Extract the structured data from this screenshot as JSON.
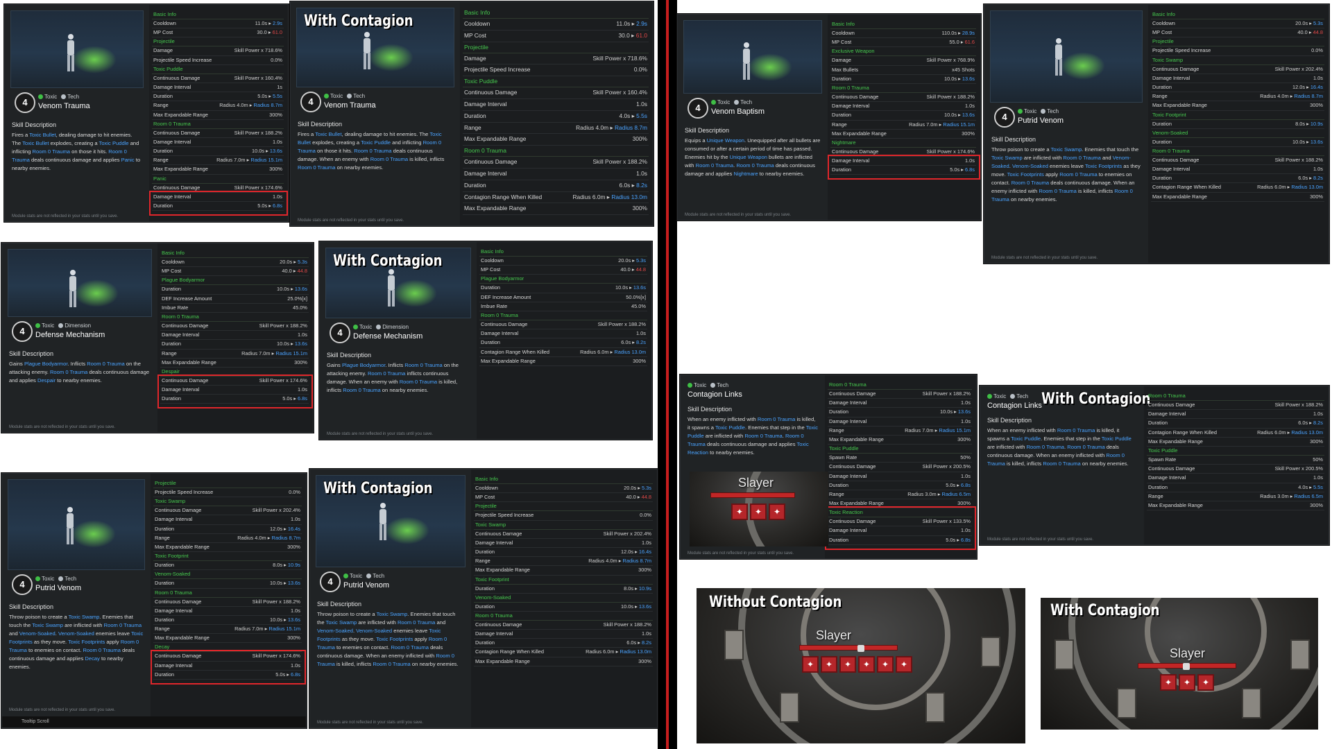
{
  "labels": {
    "skill_description": "Skill Description",
    "with_contagion": "With Contagion",
    "without_contagion": "Without Contagion",
    "module_note": "Module stats are not reflected in your stats until you save.",
    "tooltip_scroll": "Tooltip Scroll",
    "slayer": "Slayer"
  },
  "cards": {
    "venom_base": {
      "level": "4",
      "tag1": "Toxic",
      "tag2": "Tech",
      "name": "Venom Trauma",
      "desc": "Fires a Toxic Bullet, dealing damage to hit enemies. The Toxic Bullet explodes, creating a Toxic Puddle and inflicting Room 0 Trauma on those it hits. Room 0 Trauma deals continuous damage and applies Panic to nearby enemies.",
      "rows": [
        [
          "sec",
          "Basic Info"
        ],
        [
          "Cooldown",
          "11.0s ▸ 2.9s"
        ],
        [
          "MP Cost",
          "30.0 ▸ 61.0"
        ],
        [
          "sec",
          "Projectile"
        ],
        [
          "Damage",
          "Skill Power x 718.6%"
        ],
        [
          "Projectile Speed Increase",
          "0.0%"
        ],
        [
          "sec",
          "Toxic Puddle"
        ],
        [
          "Continuous Damage",
          "Skill Power x 160.4%"
        ],
        [
          "Damage Interval",
          "1s"
        ],
        [
          "Duration",
          "5.0s ▸ 5.5s"
        ],
        [
          "Range",
          "Radius 4.0m ▸ Radius 8.7m"
        ],
        [
          "Max Expandable Range",
          "300%"
        ],
        [
          "sec",
          "Room 0 Trauma"
        ],
        [
          "Continuous Damage",
          "Skill Power x 188.2%"
        ],
        [
          "Damage Interval",
          "1.0s"
        ],
        [
          "Duration",
          "10.0s ▸ 13.6s"
        ],
        [
          "Range",
          "Radius 7.0m ▸ Radius 15.1m"
        ],
        [
          "Max Expandable Range",
          "300%"
        ],
        [
          "sec",
          "Panic"
        ],
        [
          "Continuous Damage",
          "Skill Power x 174.6%"
        ],
        [
          "Damage Interval",
          "1.0s"
        ],
        [
          "Duration",
          "5.0s ▸ 6.8s"
        ]
      ]
    },
    "venom_cont": {
      "level": "4",
      "tag1": "Toxic",
      "tag2": "Tech",
      "name": "Venom Trauma",
      "desc": "Fires a Toxic Bullet, dealing damage to hit enemies. The Toxic Bullet explodes, creating a Toxic Puddle and inflicting Room 0 Trauma on those it hits. Room 0 Trauma deals continuous damage. When an enemy with Room 0 Trauma is killed, inflicts Room 0 Trauma on nearby enemies.",
      "rows": [
        [
          "sec",
          "Basic Info"
        ],
        [
          "Cooldown",
          "11.0s ▸ 2.9s"
        ],
        [
          "MP Cost",
          "30.0 ▸ 61.0"
        ],
        [
          "sec",
          "Projectile"
        ],
        [
          "Damage",
          "Skill Power x 718.6%"
        ],
        [
          "Projectile Speed Increase",
          "0.0%"
        ],
        [
          "sec",
          "Toxic Puddle"
        ],
        [
          "Continuous Damage",
          "Skill Power x 160.4%"
        ],
        [
          "Damage Interval",
          "1.0s"
        ],
        [
          "Duration",
          "4.0s ▸ 5.5s"
        ],
        [
          "Range",
          "Radius 4.0m ▸ Radius 8.7m"
        ],
        [
          "Max Expandable Range",
          "300%"
        ],
        [
          "sec",
          "Room 0 Trauma"
        ],
        [
          "Continuous Damage",
          "Skill Power x 188.2%"
        ],
        [
          "Damage Interval",
          "1.0s"
        ],
        [
          "Duration",
          "6.0s ▸ 8.2s"
        ],
        [
          "Contagion Range When Killed",
          "Radius 6.0m ▸ Radius 13.0m"
        ],
        [
          "Max Expandable Range",
          "300%"
        ]
      ]
    },
    "defense_base": {
      "level": "4",
      "tag1": "Toxic",
      "tag2": "Dimension",
      "name": "Defense Mechanism",
      "desc": "Gains Plague Bodyarmor. Inflicts Room 0 Trauma on the attacking enemy. Room 0 Trauma deals continuous damage and applies Despair to nearby enemies.",
      "rows": [
        [
          "sec",
          "Basic Info"
        ],
        [
          "Cooldown",
          "20.0s ▸ 5.3s"
        ],
        [
          "MP Cost",
          "40.0 ▸ 44.8"
        ],
        [
          "sec",
          "Plague Bodyarmor"
        ],
        [
          "Duration",
          "10.0s ▸ 13.6s"
        ],
        [
          "DEF Increase Amount",
          "25.0%[x]"
        ],
        [
          "Imbue Rate",
          "45.0%"
        ],
        [
          "sec",
          "Room 0 Trauma"
        ],
        [
          "Continuous Damage",
          "Skill Power x 188.2%"
        ],
        [
          "Damage Interval",
          "1.0s"
        ],
        [
          "Duration",
          "10.0s ▸ 13.6s"
        ],
        [
          "Range",
          "Radius 7.0m ▸ Radius 15.1m"
        ],
        [
          "Max Expandable Range",
          "300%"
        ],
        [
          "sec",
          "Despair"
        ],
        [
          "Continuous Damage",
          "Skill Power x 174.6%"
        ],
        [
          "Damage Interval",
          "1.0s"
        ],
        [
          "Duration",
          "5.0s ▸ 6.8s"
        ]
      ]
    },
    "defense_cont": {
      "level": "4",
      "tag1": "Toxic",
      "tag2": "Dimension",
      "name": "Defense Mechanism",
      "desc": "Gains Plague Bodyarmor. Inflicts Room 0 Trauma on the attacking enemy. Room 0 Trauma inflicts continuous damage. When an enemy with Room 0 Trauma is killed, inflicts Room 0 Trauma on nearby enemies.",
      "rows": [
        [
          "sec",
          "Basic Info"
        ],
        [
          "Cooldown",
          "20.0s ▸ 5.3s"
        ],
        [
          "MP Cost",
          "40.0 ▸ 44.8"
        ],
        [
          "sec",
          "Plague Bodyarmor"
        ],
        [
          "Duration",
          "10.0s ▸ 13.6s"
        ],
        [
          "DEF Increase Amount",
          "50.0%[x]"
        ],
        [
          "Imbue Rate",
          "45.0%"
        ],
        [
          "sec",
          "Room 0 Trauma"
        ],
        [
          "Continuous Damage",
          "Skill Power x 188.2%"
        ],
        [
          "Damage Interval",
          "1.0s"
        ],
        [
          "Duration",
          "6.0s ▸ 8.2s"
        ],
        [
          "Contagion Range When Killed",
          "Radius 6.0m ▸ Radius 13.0m"
        ],
        [
          "Max Expandable Range",
          "300%"
        ]
      ]
    },
    "putrid_base": {
      "level": "4",
      "tag1": "Toxic",
      "tag2": "Tech",
      "name": "Putrid Venom",
      "desc": "Throw poison to create a Toxic Swamp. Enemies that touch the Toxic Swamp are inflicted with Room 0 Trauma and Venom-Soaked. Venom-Soaked enemies leave Toxic Footprints as they move. Toxic Footprints apply Room 0 Trauma to enemies on contact. Room 0 Trauma deals continuous damage and applies Decay to nearby enemies.",
      "rows": [
        [
          "sec",
          "Projectile"
        ],
        [
          "Projectile Speed Increase",
          "0.0%"
        ],
        [
          "sec",
          "Toxic Swamp"
        ],
        [
          "Continuous Damage",
          "Skill Power x 202.4%"
        ],
        [
          "Damage Interval",
          "1.0s"
        ],
        [
          "Duration",
          "12.0s ▸ 16.4s"
        ],
        [
          "Range",
          "Radius 4.0m ▸ Radius 8.7m"
        ],
        [
          "Max Expandable Range",
          "300%"
        ],
        [
          "sec",
          "Toxic Footprint"
        ],
        [
          "Duration",
          "8.0s ▸ 10.9s"
        ],
        [
          "sec",
          "Venom-Soaked"
        ],
        [
          "Duration",
          "10.0s ▸ 13.6s"
        ],
        [
          "sec",
          "Room 0 Trauma"
        ],
        [
          "Continuous Damage",
          "Skill Power x 188.2%"
        ],
        [
          "Damage Interval",
          "1.0s"
        ],
        [
          "Duration",
          "10.0s ▸ 13.6s"
        ],
        [
          "Range",
          "Radius 7.0m ▸ Radius 15.1m"
        ],
        [
          "Max Expandable Range",
          "300%"
        ],
        [
          "sec",
          "Decay"
        ],
        [
          "Continuous Damage",
          "Skill Power x 174.6%"
        ],
        [
          "Damage Interval",
          "1.0s"
        ],
        [
          "Duration",
          "5.0s ▸ 6.8s"
        ]
      ]
    },
    "putrid_cont": {
      "level": "4",
      "tag1": "Toxic",
      "tag2": "Tech",
      "name": "Putrid Venom",
      "desc": "Throw poison to create a Toxic Swamp. Enemies that touch the Toxic Swamp are inflicted with Room 0 Trauma and Venom-Soaked. Venom-Soaked enemies leave Toxic Footprints as they move. Toxic Footprints apply Room 0 Trauma to enemies on contact. Room 0 Trauma deals continuous damage. When an enemy inflicted with Room 0 Trauma is killed, inflicts Room 0 Trauma on nearby enemies.",
      "rows": [
        [
          "sec",
          "Basic Info"
        ],
        [
          "Cooldown",
          "20.0s ▸ 5.3s"
        ],
        [
          "MP Cost",
          "40.0 ▸ 44.8"
        ],
        [
          "sec",
          "Projectile"
        ],
        [
          "Projectile Speed Increase",
          "0.0%"
        ],
        [
          "sec",
          "Toxic Swamp"
        ],
        [
          "Continuous Damage",
          "Skill Power x 202.4%"
        ],
        [
          "Damage Interval",
          "1.0s"
        ],
        [
          "Duration",
          "12.0s ▸ 16.4s"
        ],
        [
          "Range",
          "Radius 4.0m ▸ Radius 8.7m"
        ],
        [
          "Max Expandable Range",
          "300%"
        ],
        [
          "sec",
          "Toxic Footprint"
        ],
        [
          "Duration",
          "8.0s ▸ 10.9s"
        ],
        [
          "sec",
          "Venom-Soaked"
        ],
        [
          "Duration",
          "10.0s ▸ 13.6s"
        ],
        [
          "sec",
          "Room 0 Trauma"
        ],
        [
          "Continuous Damage",
          "Skill Power x 188.2%"
        ],
        [
          "Damage Interval",
          "1.0s"
        ],
        [
          "Duration",
          "6.0s ▸ 8.2s"
        ],
        [
          "Contagion Range When Killed",
          "Radius 6.0m ▸ Radius 13.0m"
        ],
        [
          "Max Expandable Range",
          "300%"
        ]
      ]
    },
    "baptism_base": {
      "level": "4",
      "tag1": "Toxic",
      "tag2": "Tech",
      "name": "Venom Baptism",
      "desc": "Equips a Unique Weapon. Unequipped after all bullets are consumed or after a certain period of time has passed. Enemies hit by the Unique Weapon bullets are inflicted with Room 0 Trauma. Room 0 Trauma deals continuous damage and applies Nightmare to nearby enemies.",
      "rows": [
        [
          "sec",
          "Basic Info"
        ],
        [
          "Cooldown",
          "110.0s ▸ 28.9s"
        ],
        [
          "MP Cost",
          "55.0 ▸ 61.6"
        ],
        [
          "sec",
          "Exclusive Weapon"
        ],
        [
          "Damage",
          "Skill Power x 768.9%"
        ],
        [
          "Max Bullets",
          "x45 Shots"
        ],
        [
          "Duration",
          "10.0s ▸ 13.6s"
        ],
        [
          "sec",
          "Room 0 Trauma"
        ],
        [
          "Continuous Damage",
          "Skill Power x 188.2%"
        ],
        [
          "Damage Interval",
          "1.0s"
        ],
        [
          "Duration",
          "10.0s ▸ 13.6s"
        ],
        [
          "Range",
          "Radius 7.0m ▸ Radius 15.1m"
        ],
        [
          "Max Expandable Range",
          "300%"
        ],
        [
          "sec",
          "Nightmare"
        ],
        [
          "Continuous Damage",
          "Skill Power x 174.6%"
        ],
        [
          "Damage Interval",
          "1.0s"
        ],
        [
          "Duration",
          "5.0s ▸ 6.8s"
        ]
      ]
    },
    "putrid_right": {
      "level": "4",
      "tag1": "Toxic",
      "tag2": "Tech",
      "name": "Putrid Venom",
      "desc": "Throw poison to create a Toxic Swamp. Enemies that touch the Toxic Swamp are inflicted with Room 0 Trauma and Venom-Soaked. Venom-Soaked enemies leave Toxic Footprints as they move. Toxic Footprints apply Room 0 Trauma to enemies on contact. Room 0 Trauma deals continuous damage. When an enemy inflicted with Room 0 Trauma is killed, inflicts Room 0 Trauma on nearby enemies.",
      "rows": [
        [
          "sec",
          "Basic Info"
        ],
        [
          "Cooldown",
          "20.0s ▸ 5.3s"
        ],
        [
          "MP Cost",
          "40.0 ▸ 44.8"
        ],
        [
          "sec",
          "Projectile"
        ],
        [
          "Projectile Speed Increase",
          "0.0%"
        ],
        [
          "sec",
          "Toxic Swamp"
        ],
        [
          "Continuous Damage",
          "Skill Power x 202.4%"
        ],
        [
          "Damage Interval",
          "1.0s"
        ],
        [
          "Duration",
          "12.0s ▸ 16.4s"
        ],
        [
          "Range",
          "Radius 4.0m ▸ Radius 8.7m"
        ],
        [
          "Max Expandable Range",
          "300%"
        ],
        [
          "sec",
          "Toxic Footprint"
        ],
        [
          "Duration",
          "8.0s ▸ 10.9s"
        ],
        [
          "sec",
          "Venom-Soaked"
        ],
        [
          "Duration",
          "10.0s ▸ 13.6s"
        ],
        [
          "sec",
          "Room 0 Trauma"
        ],
        [
          "Continuous Damage",
          "Skill Power x 188.2%"
        ],
        [
          "Damage Interval",
          "1.0s"
        ],
        [
          "Duration",
          "6.0s ▸ 8.2s"
        ],
        [
          "Contagion Range When Killed",
          "Radius 6.0m ▸ Radius 13.0m"
        ],
        [
          "Max Expandable Range",
          "300%"
        ]
      ]
    },
    "links_base": {
      "tag1": "Toxic",
      "tag2": "Tech",
      "name": "Contagion Links",
      "desc": "When an enemy inflicted with Room 0 Trauma is killed, it spawns a Toxic Puddle. Enemies that step in the Toxic Puddle are inflicted with Room 0 Trauma. Room 0 Trauma deals continuous damage and applies Toxic Reaction to nearby enemies.",
      "rows": [
        [
          "sec",
          "Room 0 Trauma"
        ],
        [
          "Continuous Damage",
          "Skill Power x 188.2%"
        ],
        [
          "Damage Interval",
          "1.0s"
        ],
        [
          "Duration",
          "10.0s ▸ 13.6s"
        ],
        [
          "Damage Interval",
          "1.0s"
        ],
        [
          "Range",
          "Radius 7.0m ▸ Radius 15.1m"
        ],
        [
          "Max Expandable Range",
          "300%"
        ],
        [
          "sec",
          "Toxic Puddle"
        ],
        [
          "Spawn Rate",
          "50%"
        ],
        [
          "Continuous Damage",
          "Skill Power x 200.5%"
        ],
        [
          "Damage Interval",
          "1.0s"
        ],
        [
          "Duration",
          "5.0s ▸ 6.8s"
        ],
        [
          "Range",
          "Radius 3.0m ▸ Radius 6.5m"
        ],
        [
          "Max Expandable Range",
          "300%"
        ],
        [
          "sec",
          "Toxic Reaction"
        ],
        [
          "Continuous Damage",
          "Skill Power x 133.5%"
        ],
        [
          "Damage Interval",
          "1.0s"
        ],
        [
          "Duration",
          "5.0s ▸ 6.8s"
        ]
      ]
    },
    "links_cont": {
      "tag1": "Toxic",
      "tag2": "Tech",
      "name": "Contagion Links",
      "desc": "When an enemy inflicted with Room 0 Trauma is killed, it spawns a Toxic Puddle. Enemies that step in the Toxic Puddle are inflicted with Room 0 Trauma. Room 0 Trauma deals continuous damage. When an enemy inflicted with Room 0 Trauma is killed, inflicts Room 0 Trauma on nearby enemies.",
      "rows": [
        [
          "sec",
          "Room 0 Trauma"
        ],
        [
          "Continuous Damage",
          "Skill Power x 188.2%"
        ],
        [
          "Damage Interval",
          "1.0s"
        ],
        [
          "Duration",
          "6.0s ▸ 8.2s"
        ],
        [
          "Contagion Range When Killed",
          "Radius 6.0m ▸ Radius 13.0m"
        ],
        [
          "Max Expandable Range",
          "300%"
        ],
        [
          "sec",
          "Toxic Puddle"
        ],
        [
          "Spawn Rate",
          "50%"
        ],
        [
          "Continuous Damage",
          "Skill Power x 200.5%"
        ],
        [
          "Damage Interval",
          "1.0s"
        ],
        [
          "Duration",
          "4.0s ▸ 5.5s"
        ],
        [
          "Range",
          "Radius 3.0m ▸ Radius 6.5m"
        ],
        [
          "Max Expandable Range",
          "300%"
        ]
      ]
    }
  }
}
